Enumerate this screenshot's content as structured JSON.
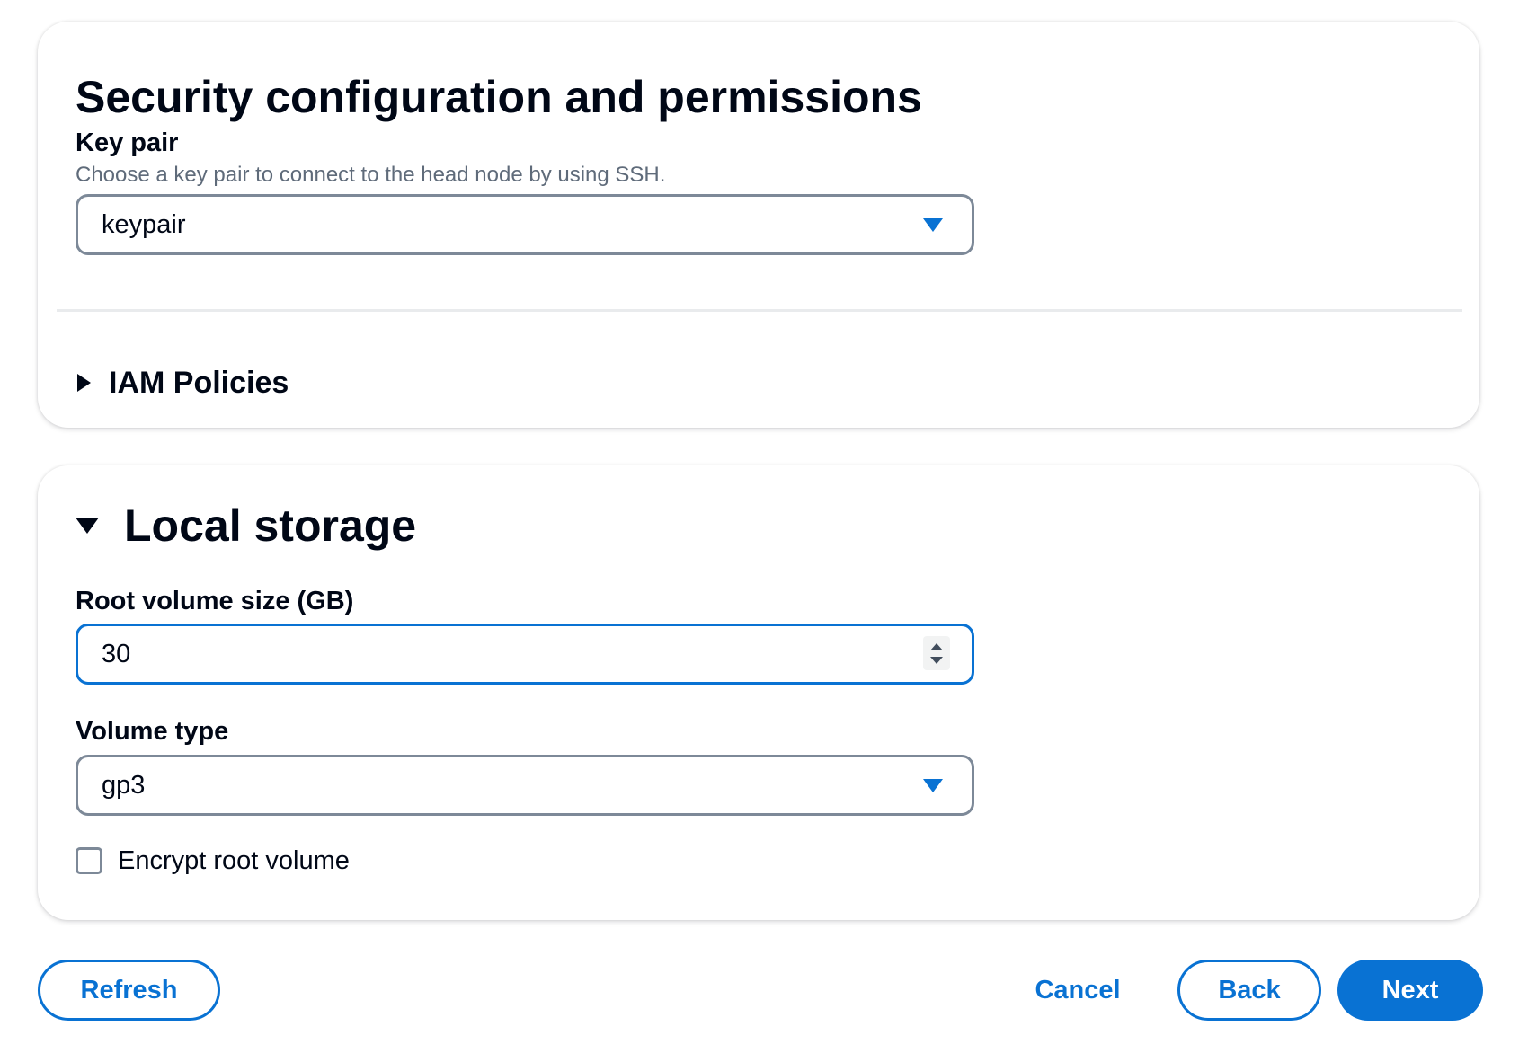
{
  "security": {
    "title": "Security configuration and permissions",
    "key_pair": {
      "label": "Key pair",
      "description": "Choose a key pair to connect to the head node by using SSH.",
      "value": "keypair"
    },
    "iam_policies": {
      "label": "IAM Policies",
      "expanded": false
    }
  },
  "storage": {
    "title": "Local storage",
    "expanded": true,
    "root_volume_size": {
      "label": "Root volume size (GB)",
      "value": "30"
    },
    "volume_type": {
      "label": "Volume type",
      "value": "gp3"
    },
    "encrypt": {
      "label": "Encrypt root volume",
      "checked": false
    }
  },
  "actions": {
    "refresh": "Refresh",
    "cancel": "Cancel",
    "back": "Back",
    "next": "Next"
  },
  "colors": {
    "accent": "#0972d3",
    "text": "#000716",
    "muted": "#5f6b7a",
    "border": "#7d8998"
  },
  "icons": {
    "select_caret": "caret-down-filled-icon",
    "collapsed": "caret-right-filled-icon",
    "expanded": "caret-down-filled-icon"
  }
}
